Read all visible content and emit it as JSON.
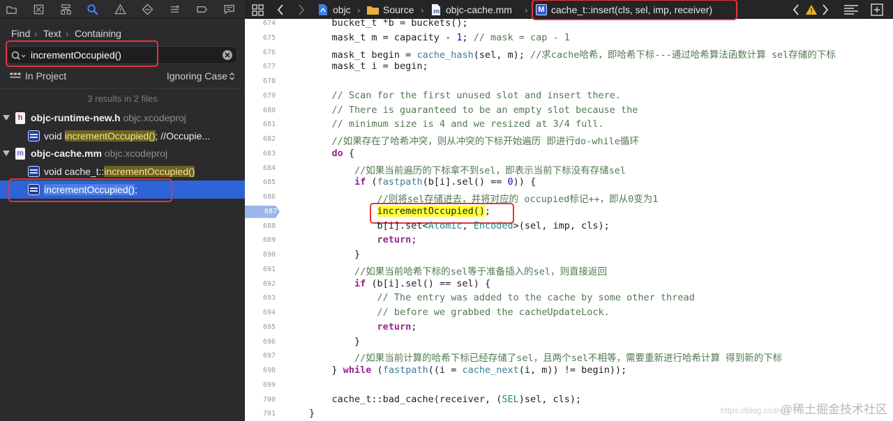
{
  "navigator": {
    "toolbar_icons": [
      "folder-icon",
      "source-control-icon",
      "symbol-icon",
      "find-icon",
      "issue-icon",
      "test-icon",
      "debug-icon",
      "breakpoint-icon",
      "report-icon"
    ],
    "find_mode": [
      "Find",
      "Text",
      "Containing"
    ],
    "search": {
      "value": "incrementOccupied()",
      "placeholder": ""
    },
    "scope": "In Project",
    "case_option": "Ignoring Case",
    "summary": "3 results in 2 files",
    "results": [
      {
        "file": "objc-runtime-new.h",
        "project": "objc.xcodeproj",
        "icon_letter": "h",
        "lines": [
          {
            "prefix": "void ",
            "match": "incrementOccupied()",
            "suffix": "; //Occupie..."
          }
        ]
      },
      {
        "file": "objc-cache.mm",
        "project": "objc.xcodeproj",
        "icon_letter": "m",
        "lines": [
          {
            "prefix": "void cache_t::",
            "match": "incrementOccupied()",
            "suffix": ""
          },
          {
            "prefix": "",
            "match": "incrementOccupied()",
            "suffix": ";"
          }
        ]
      }
    ]
  },
  "jump_bar": {
    "crumbs": [
      "objc",
      "Source",
      "objc-cache.mm"
    ],
    "method_badge": "M",
    "method": "cache_t::insert(cls, sel, imp, receiver)"
  },
  "editor": {
    "current_line": 687,
    "lines": [
      {
        "n": 674,
        "text": "    bucket_t *b = buckets();"
      },
      {
        "n": 675,
        "text": "    mask_t m = capacity - 1; // mask = cap - 1"
      },
      {
        "n": 676,
        "text": "    mask_t begin = cache_hash(sel, m); //求cache哈希，即哈希下标---通过哈希算法函数计算 sel存储的下标"
      },
      {
        "n": 677,
        "text": "    mask_t i = begin;"
      },
      {
        "n": 678,
        "text": ""
      },
      {
        "n": 679,
        "text": "    // Scan for the first unused slot and insert there."
      },
      {
        "n": 680,
        "text": "    // There is guaranteed to be an empty slot because the"
      },
      {
        "n": 681,
        "text": "    // minimum size is 4 and we resized at 3/4 full."
      },
      {
        "n": 682,
        "text": "    //如果存在了哈希冲突，则从冲突的下标开始遍历 即进行do-while循环"
      },
      {
        "n": 683,
        "text": "    do {"
      },
      {
        "n": 684,
        "text": "        //如果当前遍历的下标拿不到sel，即表示当前下标没有存储sel"
      },
      {
        "n": 685,
        "text": "        if (fastpath(b[i].sel() == 0)) {"
      },
      {
        "n": 686,
        "text": "            //则将sel存储进去，并将对应的 occupied标记++，即从0变为1"
      },
      {
        "n": 687,
        "text": "            incrementOccupied();"
      },
      {
        "n": 688,
        "text": "            b[i].set<Atomic, Encoded>(sel, imp, cls);"
      },
      {
        "n": 689,
        "text": "            return;"
      },
      {
        "n": 690,
        "text": "        }"
      },
      {
        "n": 691,
        "text": "        //如果当前哈希下标的sel等于准备插入的sel，则直接返回"
      },
      {
        "n": 692,
        "text": "        if (b[i].sel() == sel) {"
      },
      {
        "n": 693,
        "text": "            // The entry was added to the cache by some other thread"
      },
      {
        "n": 694,
        "text": "            // before we grabbed the cacheUpdateLock."
      },
      {
        "n": 695,
        "text": "            return;"
      },
      {
        "n": 696,
        "text": "        }"
      },
      {
        "n": 697,
        "text": "        //如果当前计算的哈希下标已经存储了sel，且两个sel不相等，需要重新进行哈希计算 得到新的下标"
      },
      {
        "n": 698,
        "text": "    } while (fastpath((i = cache_next(i, m)) != begin));"
      },
      {
        "n": 699,
        "text": ""
      },
      {
        "n": 700,
        "text": "    cache_t::bad_cache(receiver, (SEL)sel, cls);"
      },
      {
        "n": 701,
        "text": "}"
      }
    ]
  },
  "watermark": "@稀土掘金技术社区",
  "watermark_url": "https://blog.csdn.n",
  "colors": {
    "selection": "#2f63d8",
    "annotation": "#e3343a",
    "match_highlight": "#ffff3a"
  }
}
